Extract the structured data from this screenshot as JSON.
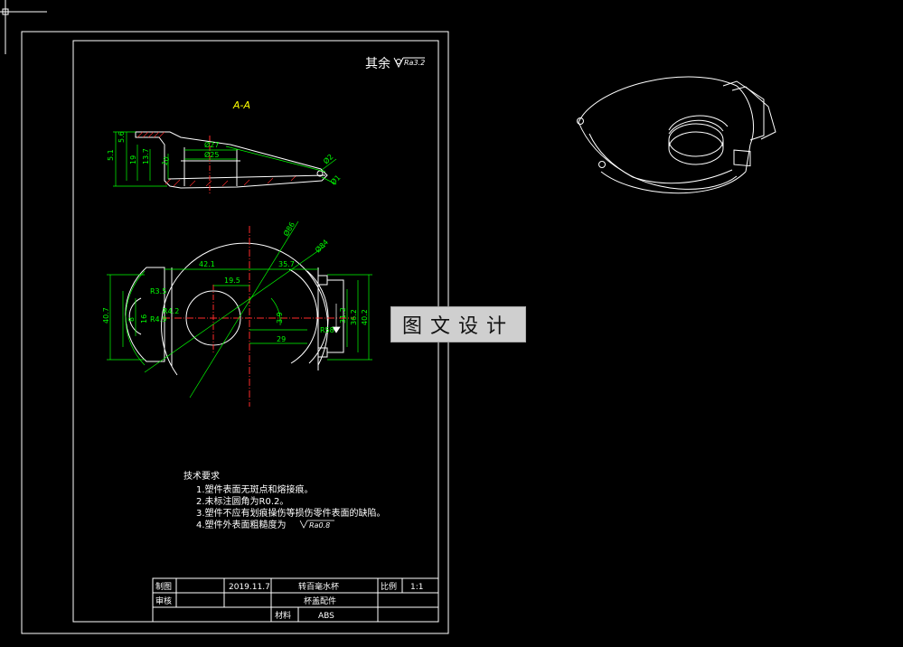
{
  "section_label": "A-A",
  "roughness_note": "其余",
  "roughness_value": "Ra3.2",
  "dims": {
    "d1": "5.1",
    "d2": "5.6",
    "d3": "19",
    "d4": "13.7",
    "d5": "10",
    "d6": "Ø27",
    "d7": "Ø25",
    "d8": "Ø2",
    "d9": "Ø1",
    "p1": "42.1",
    "p2": "19.5",
    "p3": "35.7",
    "p4": "Ø86",
    "p5": "Ø84",
    "p6": "40.7",
    "p7": "R3.5",
    "p8": "R4.2",
    "p9": "R4.9",
    "p10": "R58",
    "p11": "31.2",
    "p12": "36.2",
    "p13": "40.2",
    "p14": "29",
    "p15": "3.9",
    "p16": "8",
    "p17": "16"
  },
  "requirements": {
    "title": "技术要求",
    "items": [
      "1.塑件表面无斑点和熔接痕。",
      "2.未标注圆角为R0.2。",
      "3.塑件不应有划痕操伤等损伤零件表面的缺陷。",
      "4.塑件外表面粗糙度为"
    ],
    "item4_value": "Ra0.8"
  },
  "title_block": {
    "drawn_label": "制图",
    "checked_label": "审核",
    "date": "2019.11.7",
    "name_line1": "转百毫水杯",
    "name_line2": "杯盖配件",
    "scale_label": "比例",
    "scale_value": "1:1",
    "material_label": "材料",
    "material_value": "ABS"
  },
  "watermark": "图文设计"
}
